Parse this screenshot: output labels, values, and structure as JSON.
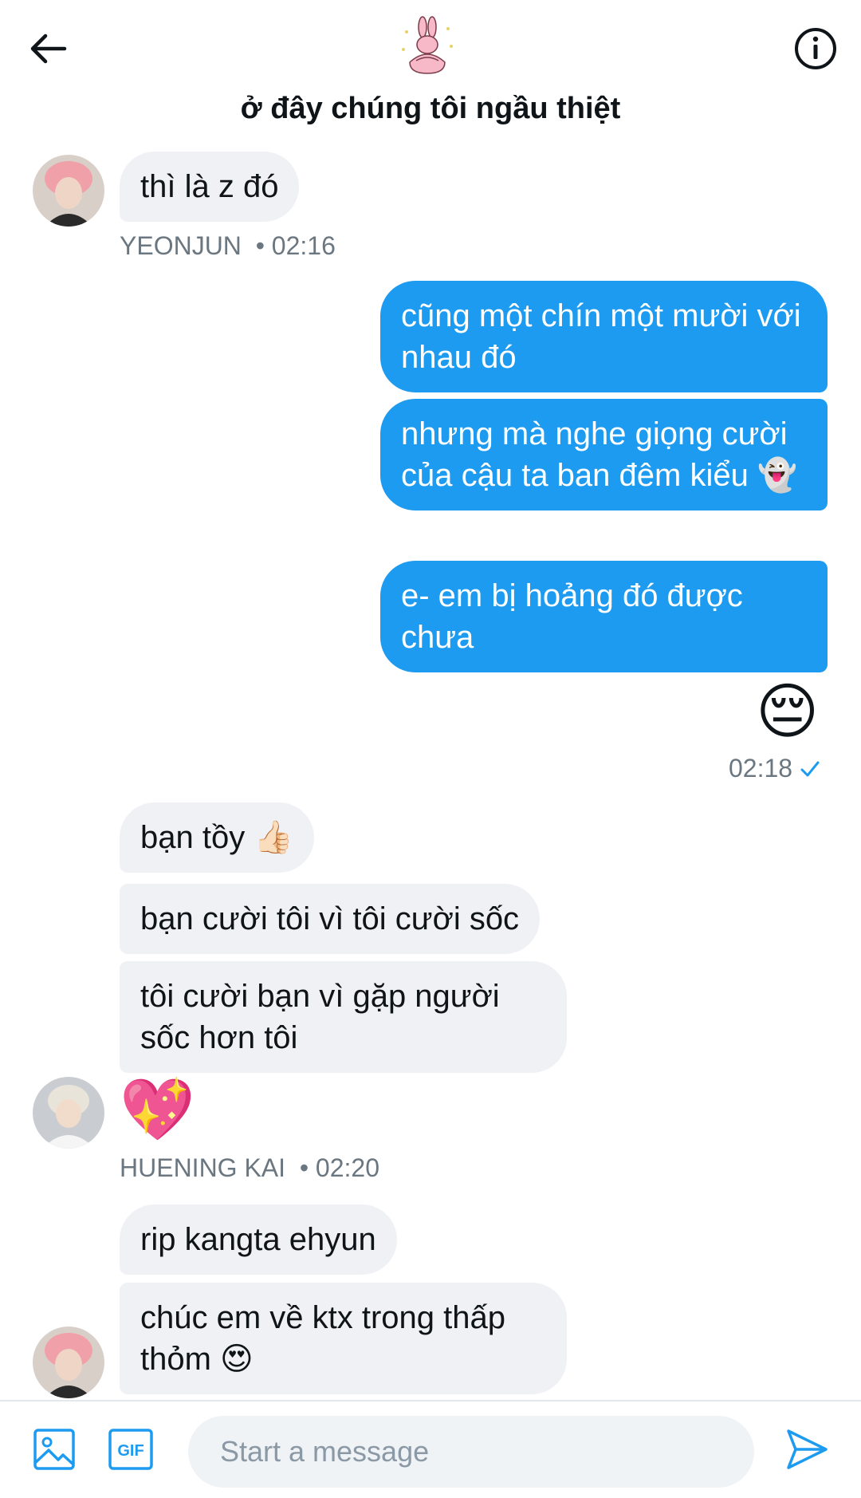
{
  "header": {
    "title": "ở đây chúng tôi ngầu thiệt"
  },
  "messages": {
    "m1": "thì là z đó",
    "m1_meta": "YEONJUN  • 02:16",
    "s1": "cũng một chín một mười với nhau đó",
    "s2": "nhưng mà nghe giọng cười của cậu ta ban đêm kiểu 👻",
    "s3": "e- em bị hoảng đó được chưa",
    "s4": "😔",
    "s_meta": "02:18",
    "r1": "bạn tồy 👍🏻",
    "r2": "bạn cười tôi vì tôi cười sốc",
    "r3": "tôi cười bạn vì gặp người sốc hơn tôi",
    "r4": "💖",
    "r_meta": "HUENING KAI  • 02:20",
    "y1": "rip kangta ehyun",
    "y2": "chúc em về ktx trong thấp thỏm 😍"
  },
  "composer": {
    "placeholder": "Start a message",
    "gif_label": "GIF"
  },
  "colors": {
    "accent": "#1d9bf0",
    "received_bubble": "#eff1f4",
    "meta_text": "#6b7780"
  },
  "icons": [
    "back-arrow-icon",
    "info-icon",
    "image-icon",
    "gif-icon",
    "send-icon",
    "check-icon"
  ]
}
